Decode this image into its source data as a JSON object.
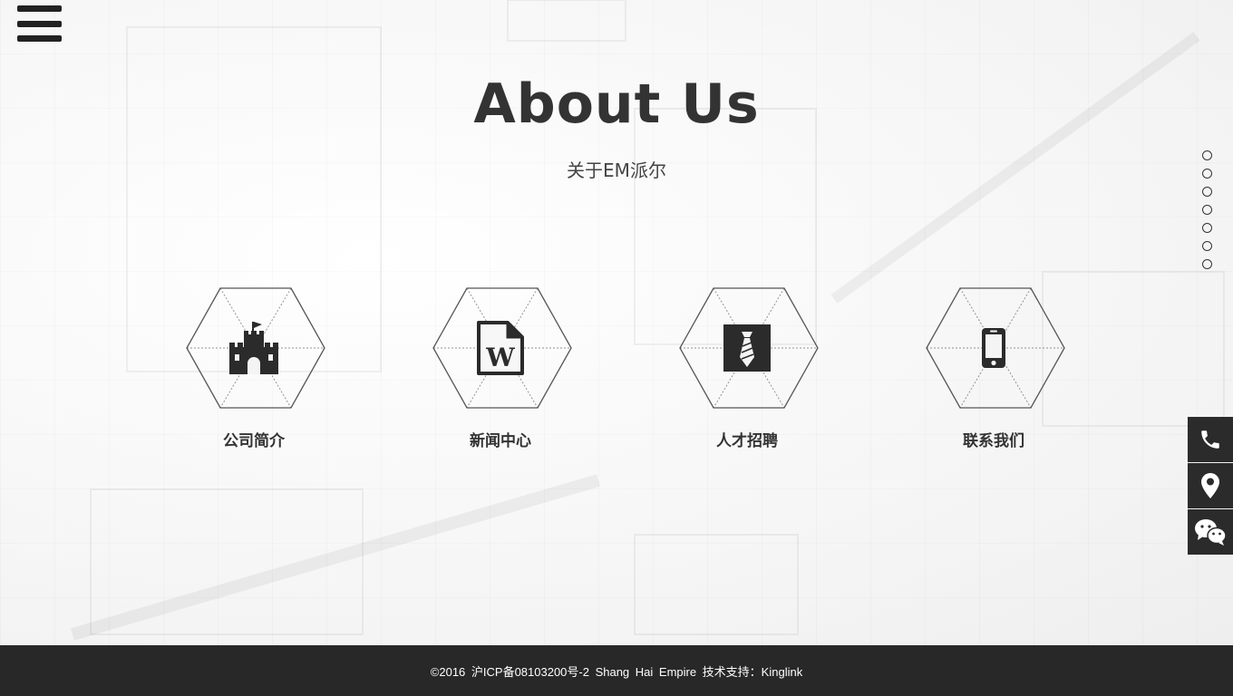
{
  "header": {
    "title": "About Us",
    "subtitle": "关于EM派尔"
  },
  "features": [
    {
      "label": "公司简介",
      "icon": "castle-icon"
    },
    {
      "label": "新闻中心",
      "icon": "word-document-icon"
    },
    {
      "label": "人才招聘",
      "icon": "necktie-icon"
    },
    {
      "label": "联系我们",
      "icon": "mobile-phone-icon"
    }
  ],
  "pagination": {
    "dot_count": 7
  },
  "side_actions": [
    {
      "icon": "phone-icon"
    },
    {
      "icon": "location-pin-icon"
    },
    {
      "icon": "wechat-icon"
    }
  ],
  "footer": {
    "text": "©2016 沪ICP备08103200号-2 Shang Hai Empire 技术支持：Kinglink"
  },
  "colors": {
    "text": "#333333",
    "footer_bg": "#282828",
    "side_bar_bg": "#2b2b2b",
    "page_bg": "#f7f7f7"
  }
}
